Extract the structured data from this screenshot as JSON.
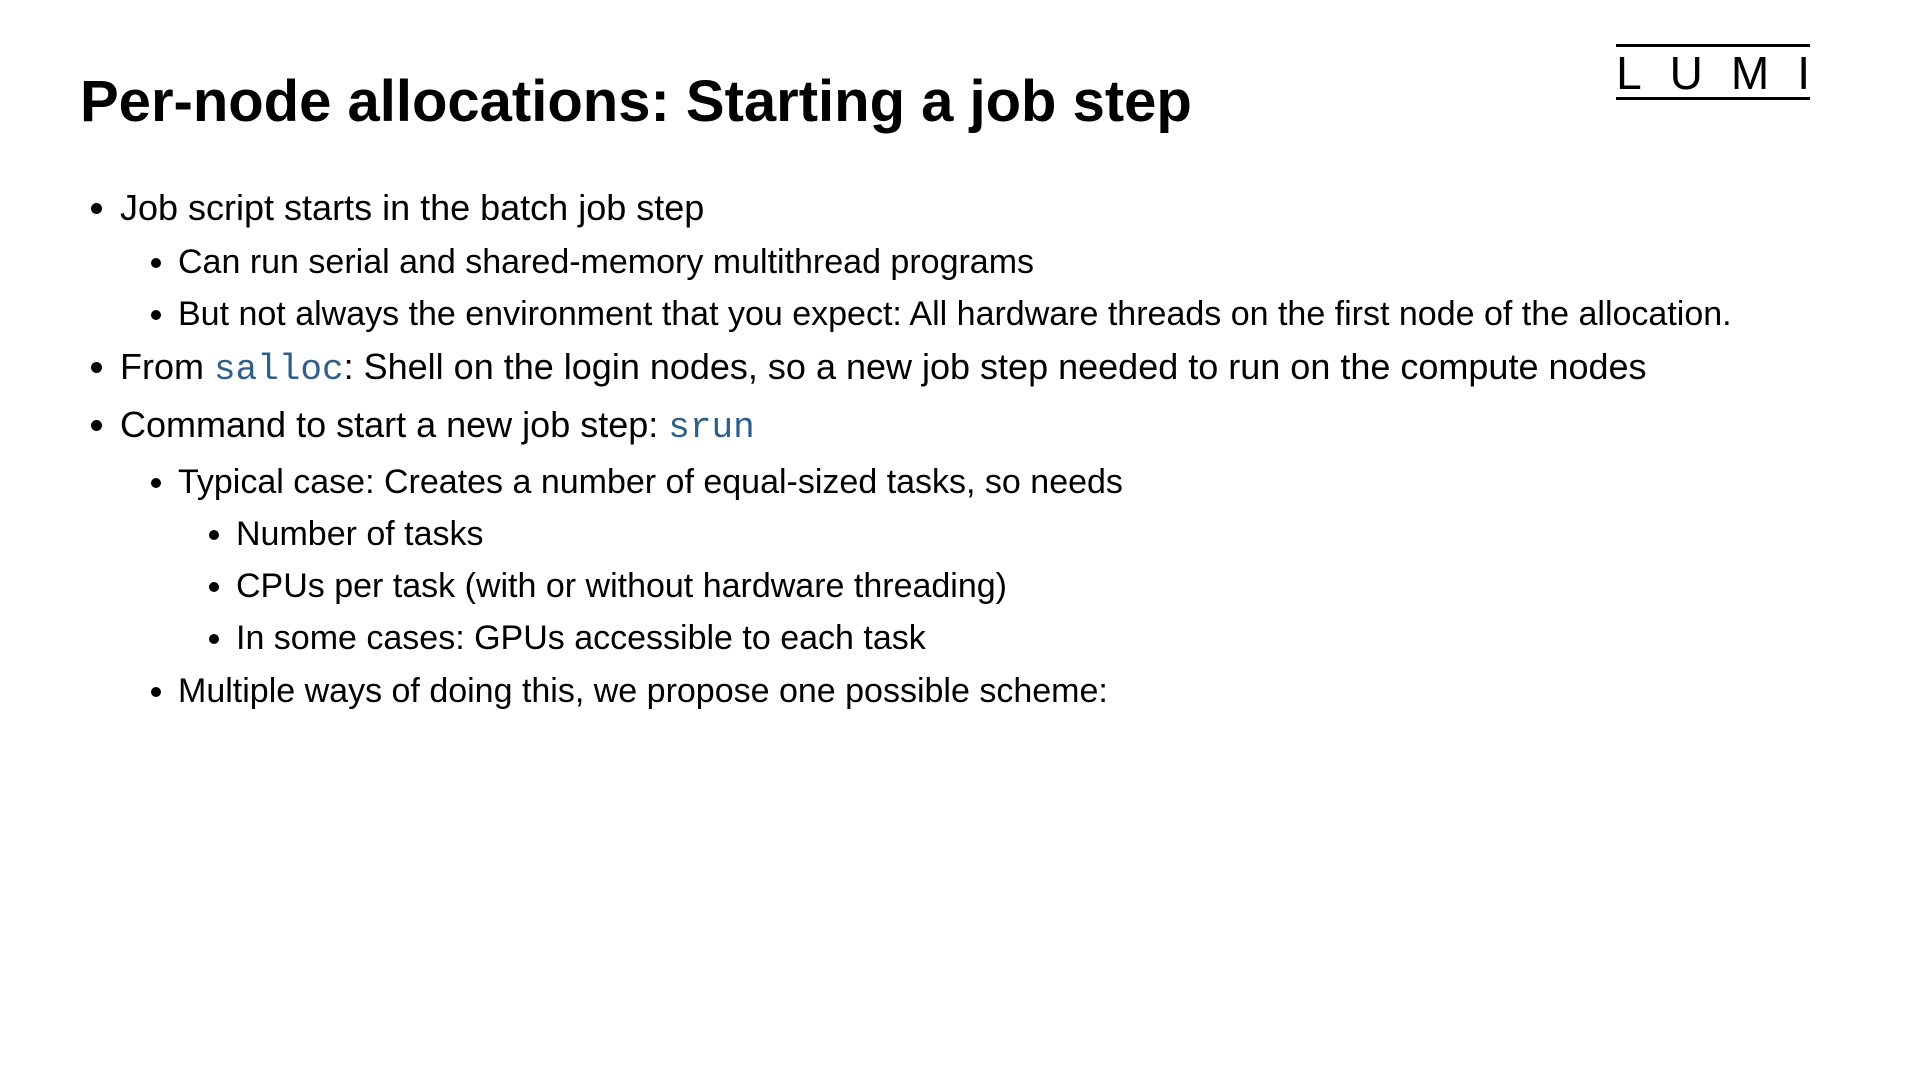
{
  "logo": "LUMI",
  "title": "Per-node allocations: Starting a job step",
  "bullets": {
    "b1": "Job script starts in the batch job step",
    "b1_1": "Can run serial and shared-memory multithread programs",
    "b1_2": "But not always the environment that you expect: All hardware threads on the first node of the allocation.",
    "b2_pre": "From ",
    "b2_code": "salloc",
    "b2_post": ": Shell on the login nodes, so a new job step needed to run on the compute nodes",
    "b3_pre": "Command to start a new job step: ",
    "b3_code": "srun",
    "b3_1": "Typical case: Creates a number of equal-sized tasks, so needs",
    "b3_1_1": "Number of tasks",
    "b3_1_2": "CPUs per task (with or without hardware threading)",
    "b3_1_3": "In some cases: GPUs accessible to each task",
    "b3_2": "Multiple ways of doing this, we propose one possible scheme:"
  }
}
